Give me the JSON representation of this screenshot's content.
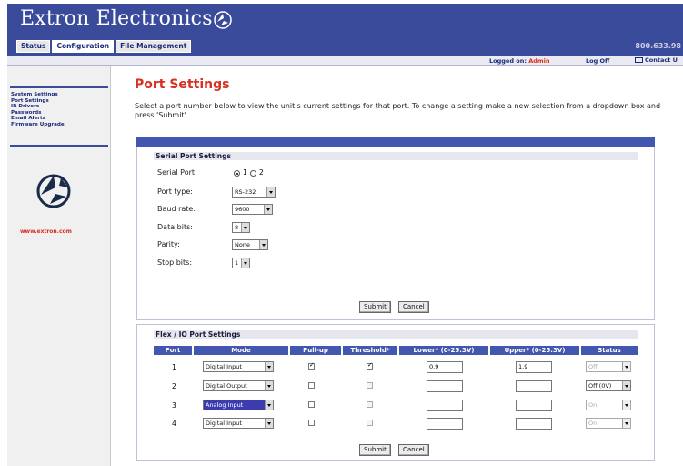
{
  "header": {
    "brand": "Extron Electronics",
    "phone": "800.633.98",
    "tabs": [
      {
        "label": "Status"
      },
      {
        "label": "Configuration"
      },
      {
        "label": "File Management"
      }
    ]
  },
  "statusbar": {
    "logged_prefix": "Logged on:",
    "user": "Admin",
    "logoff": "Log Off",
    "contact": "Contact U"
  },
  "sidebar": {
    "items": [
      "System Settings",
      "Port Settings",
      "IR Drivers",
      "Passwords",
      "Email Alerts",
      "Firmware Upgrade"
    ],
    "url": "www.extron.com"
  },
  "main": {
    "title": "Port Settings",
    "intro": "Select a port number below to view the unit's current settings for that port. To change a setting make a new selection from a dropdown box and press 'Submit'.",
    "serial": {
      "title": "Serial Port Settings",
      "serial_port_label": "Serial Port:",
      "radio_1": "1",
      "radio_2": "2",
      "selected_port": 1,
      "fields": [
        {
          "label": "Port type:",
          "value": "RS-232"
        },
        {
          "label": "Baud rate:",
          "value": "9600"
        },
        {
          "label": "Data bits:",
          "value": "8"
        },
        {
          "label": "Parity:",
          "value": "None"
        },
        {
          "label": "Stop bits:",
          "value": "1"
        }
      ],
      "submit": "Submit",
      "cancel": "Cancel"
    },
    "flex": {
      "title": "Flex / IO Port Settings",
      "columns": [
        "Port",
        "Mode",
        "Pull-up",
        "Threshold*",
        "Lower* (0-25.3V)",
        "Upper* (0-25.3V)",
        "Status"
      ],
      "rows": [
        {
          "port": "1",
          "mode": "Digital Input",
          "pullup": true,
          "threshold": true,
          "lower": "0.9",
          "upper": "1.9",
          "status": "Off",
          "status_enabled": false,
          "mode_selected": false
        },
        {
          "port": "2",
          "mode": "Digital Output",
          "pullup": false,
          "threshold": false,
          "lower": "",
          "upper": "",
          "status": "Off (0V)",
          "status_enabled": true,
          "mode_selected": false
        },
        {
          "port": "3",
          "mode": "Analog Input",
          "pullup": false,
          "threshold": false,
          "lower": "",
          "upper": "",
          "status": "On",
          "status_enabled": false,
          "mode_selected": true
        },
        {
          "port": "4",
          "mode": "Digital Input",
          "pullup": false,
          "threshold": false,
          "lower": "",
          "upper": "",
          "status": "On",
          "status_enabled": false,
          "mode_selected": false
        }
      ],
      "submit": "Submit",
      "cancel": "Cancel"
    }
  }
}
